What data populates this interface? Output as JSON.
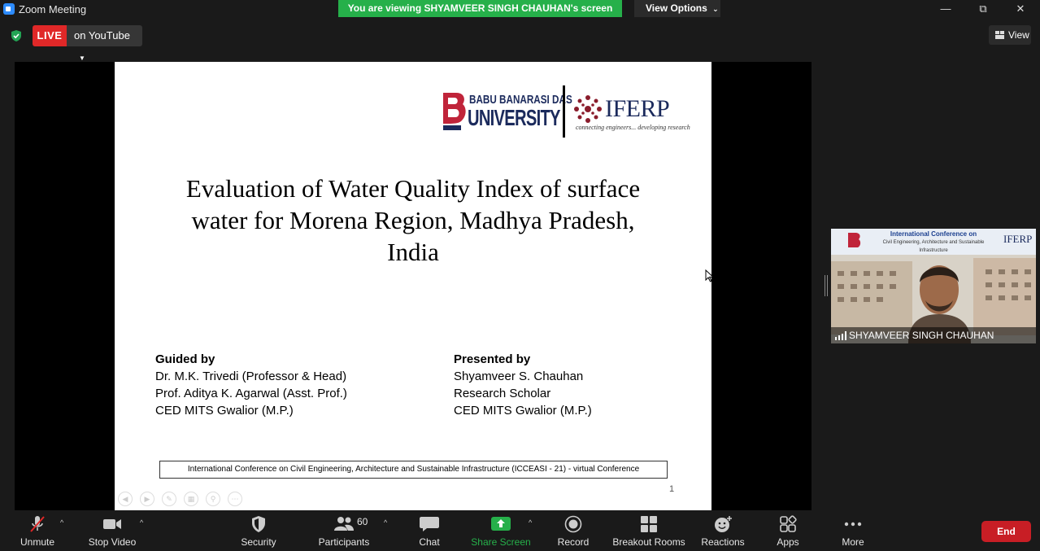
{
  "window": {
    "title": "Zoom Meeting",
    "minimize": "—",
    "maximize": "⧉",
    "close": "✕"
  },
  "banner": {
    "viewing": "You are viewing SHYAMVEER SINGH CHAUHAN's screen",
    "view_options": "View Options"
  },
  "stream": {
    "live": "LIVE",
    "platform": "on YouTube"
  },
  "view_button": "View",
  "slide": {
    "logo_bbd_line1": "BABU BANARASI DAS",
    "logo_bbd_line2": "UNIVERSITY",
    "logo_iferp": "IFERP",
    "logo_iferp_tagline": "connecting engineers... developing research",
    "title": "Evaluation of Water Quality Index of surface\nwater for Morena Region, Madhya Pradesh,\nIndia",
    "guided": {
      "heading": "Guided by",
      "lines": [
        "Dr. M.K. Trivedi (Professor & Head)",
        "Prof. Aditya K. Agarwal (Asst. Prof.)",
        "CED MITS Gwalior (M.P.)"
      ]
    },
    "presented": {
      "heading": "Presented by",
      "lines": [
        "Shyamveer S. Chauhan",
        "Research Scholar",
        "CED MITS Gwalior (M.P.)"
      ]
    },
    "conference": "International Conference on Civil Engineering, Architecture and Sustainable Infrastructure (ICCEASI - 21) - virtual Conference",
    "page_number": "1"
  },
  "video": {
    "participant_name": "SHYAMVEER SINGH CHAUHAN",
    "banner_title": "International Conference on",
    "banner_subtitle": "Civil Engineering, Architecture and Sustainable Infrastructure",
    "banner_logo": "IFERP"
  },
  "toolbar": {
    "unmute": "Unmute",
    "stop_video": "Stop Video",
    "security": "Security",
    "participants": "Participants",
    "participants_count": "60",
    "chat": "Chat",
    "share_screen": "Share Screen",
    "record": "Record",
    "breakout_rooms": "Breakout Rooms",
    "reactions": "Reactions",
    "apps": "Apps",
    "more": "More",
    "end": "End"
  },
  "colors": {
    "share_green": "#26b04a",
    "live_red": "#e02828",
    "end_red": "#c81e25",
    "toolbar_bg": "#1a1a1a"
  }
}
